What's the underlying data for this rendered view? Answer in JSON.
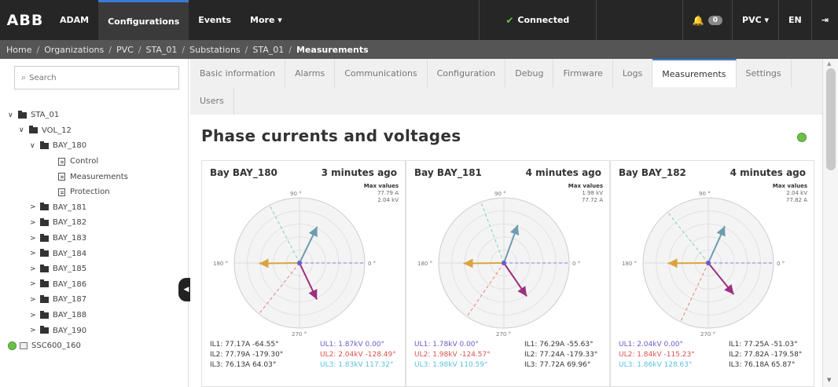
{
  "topbar": {
    "logo": "ABB",
    "nav": [
      {
        "label": "ADAM"
      },
      {
        "label": "Configurations"
      },
      {
        "label": "Events"
      },
      {
        "label": "More ▾"
      }
    ],
    "status": "Connected",
    "notifications_count": "0",
    "org_menu": "PVC ▾",
    "language": "EN",
    "logout_icon": "logout-icon"
  },
  "breadcrumb": [
    "Home",
    "Organizations",
    "PVC",
    "STA_01",
    "Substations",
    "STA_01",
    "Measurements"
  ],
  "sidebar": {
    "search_placeholder": "Search",
    "tree": [
      {
        "label": "STA_01",
        "level": 0,
        "kind": "folder",
        "expanded": true
      },
      {
        "label": "VOL_12",
        "level": 1,
        "kind": "folder",
        "expanded": true
      },
      {
        "label": "BAY_180",
        "level": 2,
        "kind": "folder",
        "expanded": true
      },
      {
        "label": "Control",
        "level": 3,
        "kind": "doc"
      },
      {
        "label": "Measurements",
        "level": 3,
        "kind": "doc"
      },
      {
        "label": "Protection",
        "level": 3,
        "kind": "doc"
      },
      {
        "label": "BAY_181",
        "level": 2,
        "kind": "folder",
        "expanded": false
      },
      {
        "label": "BAY_182",
        "level": 2,
        "kind": "folder",
        "expanded": false
      },
      {
        "label": "BAY_183",
        "level": 2,
        "kind": "folder",
        "expanded": false
      },
      {
        "label": "BAY_184",
        "level": 2,
        "kind": "folder",
        "expanded": false
      },
      {
        "label": "BAY_185",
        "level": 2,
        "kind": "folder",
        "expanded": false
      },
      {
        "label": "BAY_186",
        "level": 2,
        "kind": "folder",
        "expanded": false
      },
      {
        "label": "BAY_187",
        "level": 2,
        "kind": "folder",
        "expanded": false
      },
      {
        "label": "BAY_188",
        "level": 2,
        "kind": "folder",
        "expanded": false
      },
      {
        "label": "BAY_190",
        "level": 2,
        "kind": "folder",
        "expanded": false
      },
      {
        "label": "SSC600_160",
        "level": 0,
        "kind": "device"
      }
    ]
  },
  "tabs": {
    "row1": [
      "Basic information",
      "Alarms",
      "Communications",
      "Configuration",
      "Debug",
      "Firmware",
      "Logs",
      "Measurements",
      "Settings"
    ],
    "row2": [
      "Users"
    ],
    "active": "Measurements"
  },
  "main": {
    "title": "Phase currents and voltages",
    "status_color": "#6cc04a"
  },
  "axis_labels": {
    "top": "90 °",
    "left": "180 °",
    "right": "0 °",
    "bottom": "270 °"
  },
  "max_values_title": "Max values",
  "cards": [
    {
      "title": "Bay BAY_180",
      "time": "3 minutes ago",
      "max_values": [
        "77.79 A",
        "2.04 kV"
      ],
      "readings": {
        "IL1": "IL1: 77.17A -64.55°",
        "UL1": "UL1: 1.87kV 0.00°",
        "IL2": "IL2: 77.79A -179.30°",
        "UL2": "UL2: 2.04kV -128.49°",
        "IL3": "IL3: 76.13A 64.03°",
        "UL3": "UL3: 1.83kV 117.32°"
      },
      "phasors": [
        {
          "phase": "IL1",
          "angle": -64.55,
          "magnitude": 0.85,
          "color": "#9c2f7e"
        },
        {
          "phase": "IL2",
          "angle": -179.3,
          "magnitude": 0.85,
          "color": "#d9a441"
        },
        {
          "phase": "IL3",
          "angle": 64.03,
          "magnitude": 0.85,
          "color": "#6f9bb0"
        },
        {
          "phase": "UL1",
          "angle": 0.0,
          "magnitude": 1.0,
          "color": "#8b7ad9"
        },
        {
          "phase": "UL2",
          "angle": -128.49,
          "magnitude": 1.0,
          "color": "#e77f7f"
        },
        {
          "phase": "UL3",
          "angle": 117.32,
          "magnitude": 1.0,
          "color": "#7fd0c0"
        }
      ]
    },
    {
      "title": "Bay BAY_181",
      "time": "4 minutes ago",
      "max_values": [
        "1.98 kV",
        "77.72 A"
      ],
      "readings": {
        "UL1": "UL1: 1.78kV 0.00°",
        "IL1": "IL1: 76.29A -55.63°",
        "UL2": "UL2: 1.98kV -124.57°",
        "IL2": "IL2: 77.24A -179.33°",
        "UL3": "UL3: 1.98kV 110.59°",
        "IL3": "IL3: 77.72A 69.96°"
      },
      "phasors": [
        {
          "phase": "IL1",
          "angle": -55.63,
          "magnitude": 0.85,
          "color": "#9c2f7e"
        },
        {
          "phase": "IL2",
          "angle": -179.33,
          "magnitude": 0.85,
          "color": "#d9a441"
        },
        {
          "phase": "IL3",
          "angle": 69.96,
          "magnitude": 0.85,
          "color": "#6f9bb0"
        },
        {
          "phase": "UL1",
          "angle": 0.0,
          "magnitude": 1.0,
          "color": "#8b7ad9"
        },
        {
          "phase": "UL2",
          "angle": -124.57,
          "magnitude": 1.0,
          "color": "#e77f7f"
        },
        {
          "phase": "UL3",
          "angle": 110.59,
          "magnitude": 1.0,
          "color": "#7fd0c0"
        }
      ]
    },
    {
      "title": "Bay BAY_182",
      "time": "4 minutes ago",
      "max_values": [
        "2.04 kV",
        "77.82 A"
      ],
      "readings": {
        "UL1": "UL1: 2.04kV 0.00°",
        "IL1": "IL1: 77.25A -51.03°",
        "UL2": "UL2: 1.84kV -115.23°",
        "IL2": "IL2: 77.82A -179.58°",
        "UL3": "UL3: 1.86kV 128.63°",
        "IL3": "IL3: 76.18A 65.87°"
      },
      "phasors": [
        {
          "phase": "IL1",
          "angle": -51.03,
          "magnitude": 0.85,
          "color": "#9c2f7e"
        },
        {
          "phase": "IL2",
          "angle": -179.58,
          "magnitude": 0.85,
          "color": "#d9a441"
        },
        {
          "phase": "IL3",
          "angle": 65.87,
          "magnitude": 0.85,
          "color": "#6f9bb0"
        },
        {
          "phase": "UL1",
          "angle": 0.0,
          "magnitude": 1.0,
          "color": "#8b7ad9"
        },
        {
          "phase": "UL2",
          "angle": -115.23,
          "magnitude": 1.0,
          "color": "#e77f7f"
        },
        {
          "phase": "UL3",
          "angle": 128.63,
          "magnitude": 1.0,
          "color": "#7fd0c0"
        }
      ]
    }
  ]
}
